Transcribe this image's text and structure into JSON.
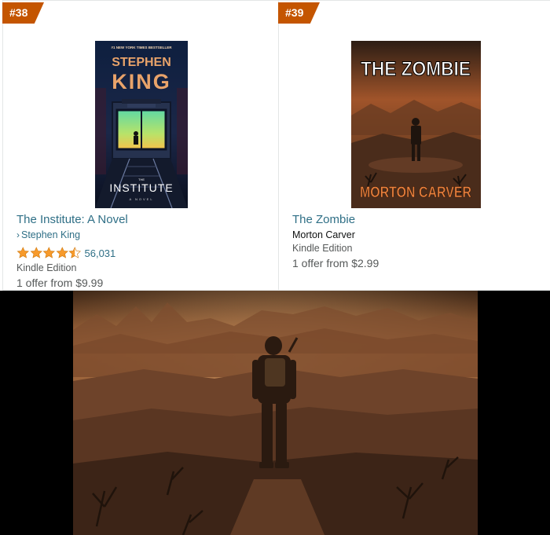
{
  "results": [
    {
      "rank": "#38",
      "title": "The Institute: A Novel",
      "author": "Stephen King",
      "author_is_link": true,
      "rating_stars": 4.5,
      "rating_count": "56,031",
      "format": "Kindle Edition",
      "offer": "1 offer from $9.99",
      "cover": {
        "top_banner": "#1 NEW YORK TIMES BESTSELLER",
        "author_first": "STEPHEN",
        "author_last": "KING",
        "subtitle": "A NOVEL",
        "the": "THE",
        "title": "INSTITUTE"
      }
    },
    {
      "rank": "#39",
      "title": "The Zombie",
      "author": "Morton Carver",
      "author_is_link": false,
      "format": "Kindle Edition",
      "offer": "1 offer from $2.99",
      "cover": {
        "title": "THE ZOMBIE",
        "author": "MORTON CARVER"
      }
    }
  ],
  "colors": {
    "rank_badge": "#c45500",
    "link": "#2f6f86",
    "star": "#f79a2b",
    "muted_text": "#565959"
  },
  "icons": {
    "author_chevron": "chevron-right-icon",
    "rating": "star-icon"
  }
}
